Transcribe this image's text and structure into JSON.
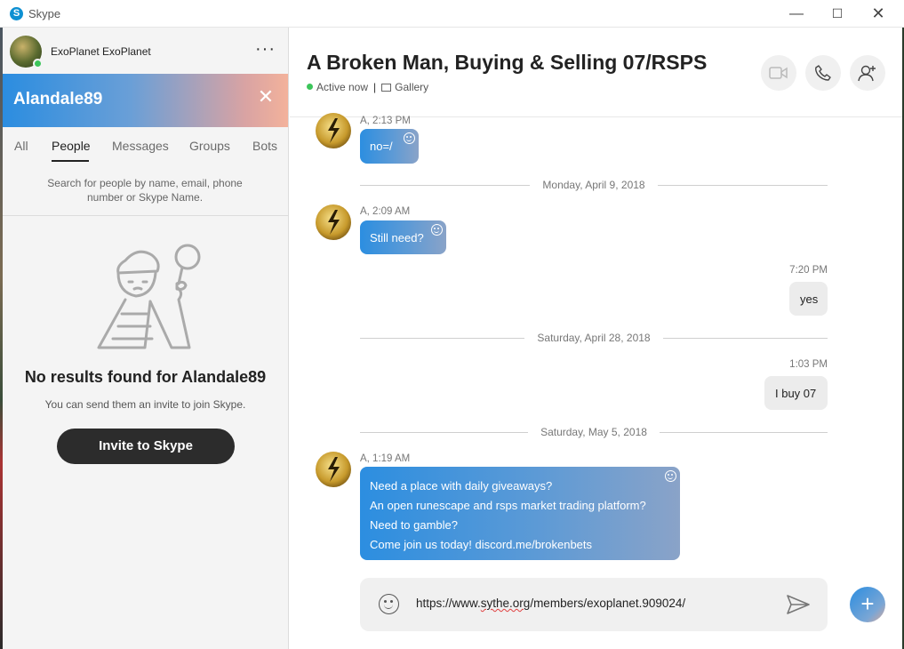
{
  "window": {
    "title": "Skype",
    "logo_letter": "S"
  },
  "profile": {
    "name": "ExoPlanet ExoPlanet",
    "more_label": "···"
  },
  "search": {
    "query": "Alandale89",
    "clear_label": "✕"
  },
  "tabs": [
    {
      "label": "All"
    },
    {
      "label": "People"
    },
    {
      "label": "Messages"
    },
    {
      "label": "Groups"
    },
    {
      "label": "Bots"
    }
  ],
  "search_hint": "Search for people by name, email, phone number or Skype Name.",
  "empty_state": {
    "title": "No results found for Alandale89",
    "subtitle": "You can send them an invite to join Skype.",
    "button_label": "Invite to Skype"
  },
  "chat": {
    "title": "A Broken Man, Buying & Selling 07/RSPS",
    "status": "Active now",
    "separator": "|",
    "gallery_label": "Gallery"
  },
  "messages": {
    "m1_sender": "A, 2:13 PM",
    "m1_text": "no=/",
    "date1": "Monday, April 9, 2018",
    "m2_sender": "A, 2:09 AM",
    "m2_text": "Still need?",
    "m3_time": "7:20 PM",
    "m3_text": "yes",
    "date2": "Saturday, April 28, 2018",
    "m4_time": "1:03 PM",
    "m4_text": "I buy 07",
    "date3": "Saturday, May 5, 2018",
    "m5_sender": "A, 1:19 AM",
    "m5_lines": [
      "Need a place with daily giveaways?",
      "An open runescape and rsps market trading platform?",
      "Need to gamble?",
      "Come join us today! discord.me/brokenbets"
    ]
  },
  "composer": {
    "text_pre": "https://www.",
    "text_misspelled": "sythe.org",
    "text_post": "/members/exoplanet.909024/"
  },
  "colors": {
    "accent": "#2b8de0",
    "presence": "#3cc55a",
    "invite_button": "#2c2c2c"
  },
  "icons": [
    "skype-logo-icon",
    "minimize-icon",
    "maximize-icon",
    "close-icon",
    "more-icon",
    "close-search-icon",
    "video-call-icon",
    "phone-icon",
    "add-contact-icon",
    "emoji-icon",
    "send-icon",
    "plus-icon",
    "gallery-icon"
  ]
}
